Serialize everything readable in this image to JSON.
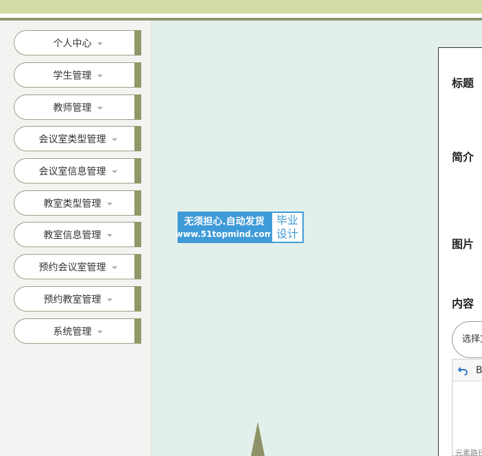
{
  "sidebar": {
    "items": [
      {
        "label": "个人中心"
      },
      {
        "label": "学生管理"
      },
      {
        "label": "教师管理"
      },
      {
        "label": "会议室类型管理"
      },
      {
        "label": "会议室信息管理"
      },
      {
        "label": "教室类型管理"
      },
      {
        "label": "教室信息管理"
      },
      {
        "label": "预约会议室管理"
      },
      {
        "label": "预约教室管理"
      },
      {
        "label": "系统管理"
      }
    ]
  },
  "watermark": {
    "slogan": "无须担心.自动发货",
    "url": "www.51topmind.com",
    "badge_line1": "毕业",
    "badge_line2": "设计"
  },
  "form": {
    "title_label": "标题",
    "intro_label": "简介",
    "image_label": "图片",
    "content_label": "内容",
    "select_button": "选择文件",
    "editor_toolbar_text": "B",
    "editor_footer_text": "元素路径"
  },
  "colors": {
    "top_bar": "#d2dba5",
    "accent": "#919867",
    "main_bg": "#e3efea",
    "watermark_blue": "#3f9ad8"
  }
}
